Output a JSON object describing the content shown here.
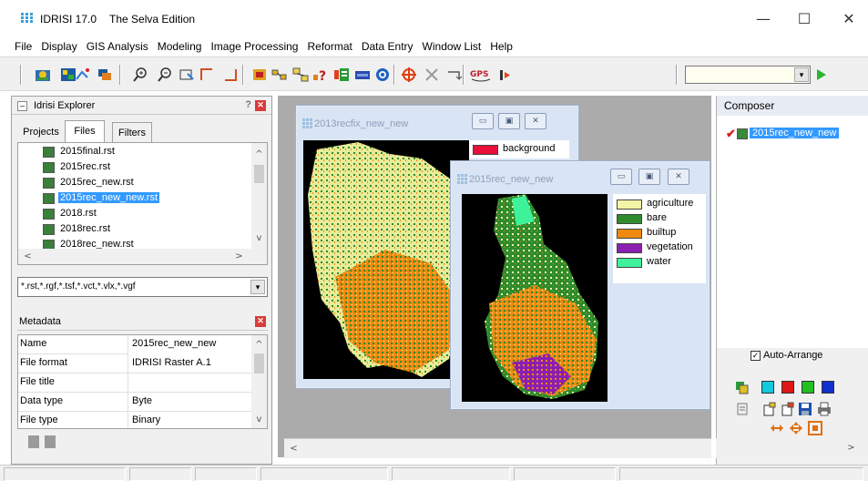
{
  "window": {
    "app_name": "IDRISI 17.0",
    "edition": "The Selva Edition",
    "min_glyph": "—",
    "max_glyph": "☐",
    "close_glyph": "✕"
  },
  "menu": [
    "File",
    "Display",
    "GIS Analysis",
    "Modeling",
    "Image Processing",
    "Reformat",
    "Data Entry",
    "Window List",
    "Help"
  ],
  "toolbar": {
    "icons": [
      "display-launcher-icon",
      "composer-icon",
      "vector-icon",
      "layer-icon",
      "zoom-in-icon",
      "zoom-out-icon",
      "pan-icon",
      "measure-icon",
      "feature-icon",
      "digitize-icon",
      "group-icon",
      "link-icon",
      "query-icon",
      "palette-icon",
      "histogram-icon",
      "globe-icon",
      "cursor-icon",
      "cross-icon",
      "move-icon",
      "gps-icon",
      "record-icon"
    ],
    "gps_label": "GPS",
    "combo_value": "",
    "combo_arrow": "▾"
  },
  "explorer": {
    "title": "Idrisi Explorer",
    "min_glyph": "–",
    "help_glyph": "?",
    "close_glyph": "✕",
    "tabs": [
      "Projects",
      "Files",
      "Filters"
    ],
    "active_tab": "Files",
    "files": [
      {
        "name": "2015final.rst",
        "selected": false
      },
      {
        "name": "2015rec.rst",
        "selected": false
      },
      {
        "name": "2015rec_new.rst",
        "selected": false
      },
      {
        "name": "2015rec_new_new.rst",
        "selected": true
      },
      {
        "name": "2018.rst",
        "selected": false
      },
      {
        "name": "2018rec.rst",
        "selected": false
      },
      {
        "name": "2018rec_new.rst",
        "selected": false
      }
    ],
    "filter": "*.rst,*.rgf,*.tsf,*.vct,*.vlx,*.vgf",
    "filter_arrow": "▾",
    "scroll_up": "^",
    "scroll_down": "v",
    "scroll_left": "<",
    "scroll_right": ">",
    "metadata_title": "Metadata",
    "metadata_close": "✕",
    "metadata": [
      {
        "key": "Name",
        "value": "2015rec_new_new"
      },
      {
        "key": "File format",
        "value": "IDRISI Raster A.1"
      },
      {
        "key": "File title",
        "value": ""
      },
      {
        "key": "Data type",
        "value": "Byte"
      },
      {
        "key": "File type",
        "value": "Binary"
      }
    ]
  },
  "map1": {
    "title": "2013recfix_new_new",
    "btn_min": "▭",
    "btn_max": "▣",
    "btn_close": "✕",
    "legend": [
      {
        "label": "background",
        "color": "#e8103a"
      }
    ]
  },
  "map2": {
    "title": "2015rec_new_new",
    "btn_min": "▭",
    "btn_max": "▣",
    "btn_close": "✕",
    "legend": [
      {
        "label": "agriculture",
        "color": "#f4f4a6"
      },
      {
        "label": "bare",
        "color": "#2e8b2e"
      },
      {
        "label": "builtup",
        "color": "#ef8a10"
      },
      {
        "label": "vegetation",
        "color": "#8b1fb0"
      },
      {
        "label": "water",
        "color": "#3ef29a"
      }
    ]
  },
  "mdi_scroll": {
    "left": "<"
  },
  "composer": {
    "title": "Composer",
    "layer_check": "✔",
    "layer": "2015rec_new_new",
    "auto_arrange_label": "Auto-Arrange",
    "auto_arrange_checked": true,
    "auto_arrange_glyph": "✓",
    "color_swatches": [
      "#11c9dc",
      "#e01616",
      "#20c020",
      "#1030d0"
    ],
    "scroll_right": ">"
  }
}
